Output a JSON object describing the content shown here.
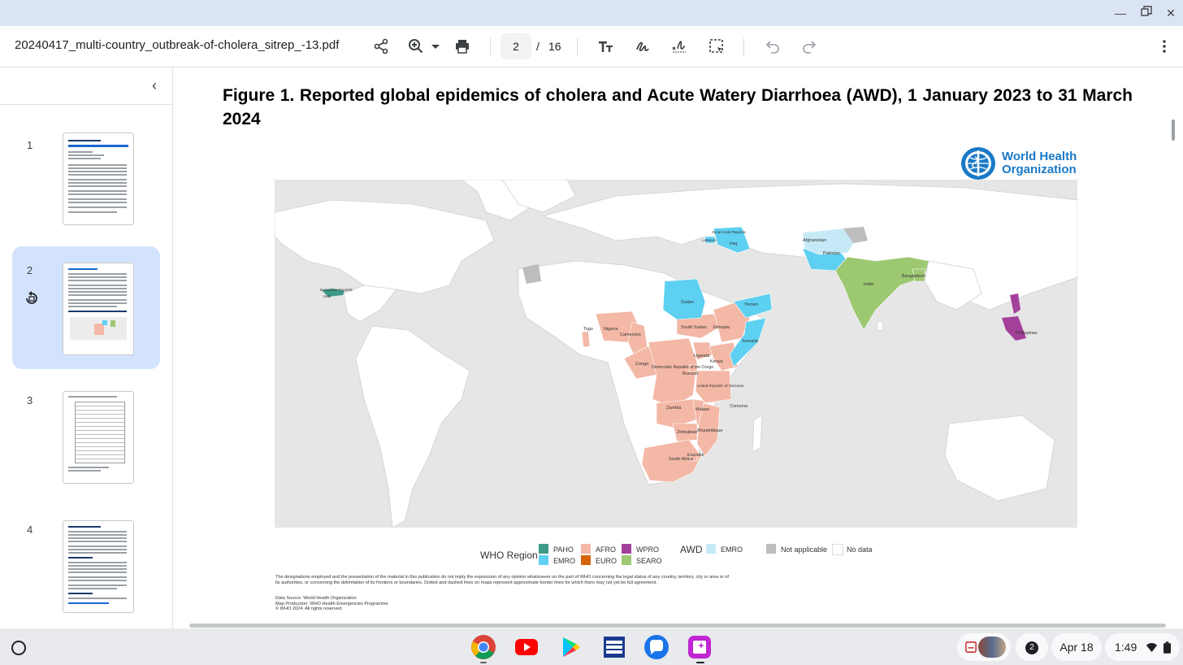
{
  "toolbar": {
    "filename": "20240417_multi-country_outbreak-of-cholera_sitrep_-13.pdf",
    "current_page": "2",
    "page_separator": "/",
    "total_pages": "16"
  },
  "sidebar": {
    "thumbnails": [
      {
        "number": "1"
      },
      {
        "number": "2"
      },
      {
        "number": "3"
      },
      {
        "number": "4"
      }
    ]
  },
  "document": {
    "figure_title": "Figure 1. Reported global epidemics of cholera and Acute Watery Diarrhoea (AWD), 1 January 2023 to 31 March 2024",
    "logo_text_1": "World Health",
    "logo_text_2": "Organization",
    "legend": {
      "title": "WHO Region",
      "awd_title": "AWD",
      "items": [
        {
          "label": "PAHO",
          "color": "#3e9b8a"
        },
        {
          "label": "AFRO",
          "color": "#f4b8a6"
        },
        {
          "label": "WPRO",
          "color": "#a3409a"
        },
        {
          "label": "EMRO",
          "color": "#5ed0f1"
        },
        {
          "label": "EURO",
          "color": "#d3640a"
        },
        {
          "label": "SEARO",
          "color": "#9dc872"
        },
        {
          "label": "EMRO",
          "color": "#c6e9f7"
        },
        {
          "label": "Not applicable",
          "color": "#bdbdbd"
        },
        {
          "label": "No data",
          "color": "#ffffff"
        }
      ]
    },
    "map_labels": [
      "Sudan",
      "Yemen",
      "Somalia",
      "Ethiopia",
      "South Sudan",
      "Nigeria",
      "Cameroon",
      "Togo",
      "Congo",
      "Democratic Republic of the Congo",
      "Uganda",
      "Kenya",
      "Burundi",
      "United Republic of Tanzania",
      "Zambia",
      "Malawi",
      "Zimbabwe",
      "Mozambique",
      "South Africa",
      "Eswatini",
      "Comoros",
      "Syrian Arab Republic",
      "Lebanon",
      "Iraq",
      "Afghanistan",
      "Pakistan",
      "India",
      "Bangladesh",
      "Philippines",
      "Dominican Republic",
      "Haiti"
    ],
    "disclaimer": "The designations employed and the presentation of the material in this publication do not imply the expression of any opinion whatsoever on the part of WHO concerning the legal status of any country, territory, city or area or of its authorities, or concerning the delimitation of its frontiers or boundaries. Dotted and dashed lines on maps represent approximate border lines for which there may not yet be full agreement.",
    "data_source": "Data Source: World Health Organization",
    "map_production": "Map Production: WHO Health Emergencies Programme",
    "copyright": "© WHO 2024. All rights reserved."
  },
  "shelf": {
    "notification_count": "2",
    "date": "Apr 18",
    "time": "1:49"
  }
}
